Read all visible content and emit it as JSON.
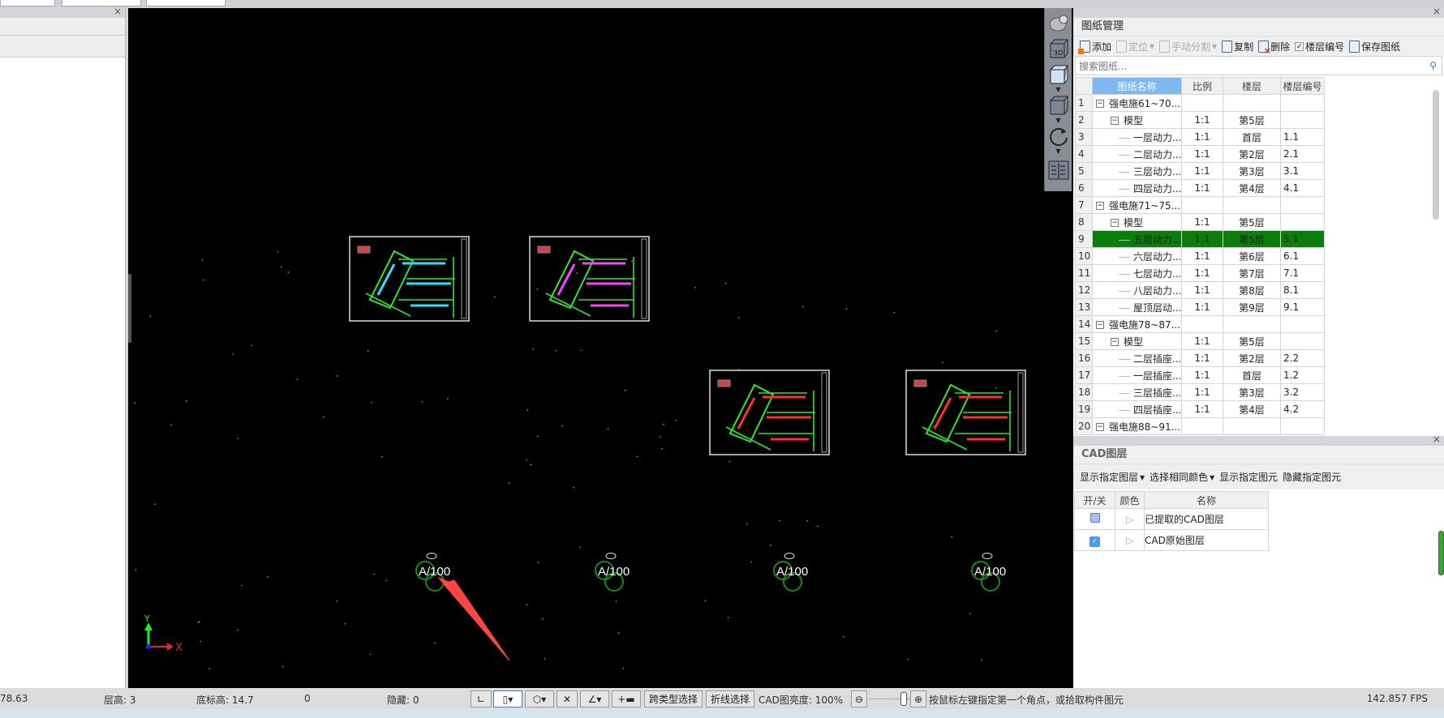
{
  "drawing_panel": {
    "title": "图纸管理",
    "toolbar": {
      "add": "添加",
      "locate": "定位",
      "split": "手动分割",
      "copy": "复制",
      "delete": "删除",
      "floor_code": "楼层编号",
      "save": "保存图纸"
    },
    "search_placeholder": "搜索图纸...",
    "columns": [
      "图纸名称",
      "比例",
      "楼层",
      "楼层编号"
    ],
    "rows": [
      {
        "n": "1",
        "name": "强电施61~70...",
        "scale": "",
        "floor": "",
        "code": "",
        "level": 0
      },
      {
        "n": "2",
        "name": "模型",
        "scale": "1:1",
        "floor": "第5层",
        "code": "",
        "level": 1
      },
      {
        "n": "3",
        "name": "一层动力...",
        "scale": "1:1",
        "floor": "首层",
        "code": "1.1",
        "level": 2
      },
      {
        "n": "4",
        "name": "二层动力...",
        "scale": "1:1",
        "floor": "第2层",
        "code": "2.1",
        "level": 2
      },
      {
        "n": "5",
        "name": "三层动力...",
        "scale": "1:1",
        "floor": "第3层",
        "code": "3.1",
        "level": 2
      },
      {
        "n": "6",
        "name": "四层动力...",
        "scale": "1:1",
        "floor": "第4层",
        "code": "4.1",
        "level": 2
      },
      {
        "n": "7",
        "name": "强电施71~75...",
        "scale": "",
        "floor": "",
        "code": "",
        "level": 0
      },
      {
        "n": "8",
        "name": "模型",
        "scale": "1:1",
        "floor": "第5层",
        "code": "",
        "level": 1
      },
      {
        "n": "9",
        "name": "五层动力...",
        "scale": "1:1",
        "floor": "第5层",
        "code": "5.1",
        "level": 2,
        "selected": true
      },
      {
        "n": "10",
        "name": "六层动力...",
        "scale": "1:1",
        "floor": "第6层",
        "code": "6.1",
        "level": 2
      },
      {
        "n": "11",
        "name": "七层动力...",
        "scale": "1:1",
        "floor": "第7层",
        "code": "7.1",
        "level": 2
      },
      {
        "n": "12",
        "name": "八层动力...",
        "scale": "1:1",
        "floor": "第8层",
        "code": "8.1",
        "level": 2
      },
      {
        "n": "13",
        "name": "屋顶层动...",
        "scale": "1:1",
        "floor": "第9层",
        "code": "9.1",
        "level": 2
      },
      {
        "n": "14",
        "name": "强电施78~87...",
        "scale": "",
        "floor": "",
        "code": "",
        "level": 0
      },
      {
        "n": "15",
        "name": "模型",
        "scale": "1:1",
        "floor": "第5层",
        "code": "",
        "level": 1
      },
      {
        "n": "16",
        "name": "二层插座...",
        "scale": "1:1",
        "floor": "第2层",
        "code": "2.2",
        "level": 2
      },
      {
        "n": "17",
        "name": "一层插座...",
        "scale": "1:1",
        "floor": "首层",
        "code": "1.2",
        "level": 2
      },
      {
        "n": "18",
        "name": "三层插座...",
        "scale": "1:1",
        "floor": "第3层",
        "code": "3.2",
        "level": 2
      },
      {
        "n": "19",
        "name": "四层插座...",
        "scale": "1:1",
        "floor": "第4层",
        "code": "4.2",
        "level": 2
      },
      {
        "n": "20",
        "name": "强电施88~91...",
        "scale": "",
        "floor": "",
        "code": "",
        "level": 0
      }
    ],
    "selected_color": "#0a7d0a"
  },
  "cad_layer_panel": {
    "title": "CAD图层",
    "toolbar": {
      "show_layer": "显示指定图层",
      "select_color": "选择相同颜色",
      "show_element": "显示指定图元",
      "hide_element": "隐藏指定图元"
    },
    "columns": [
      "开/关",
      "颜色",
      "名称"
    ],
    "rows": [
      {
        "name": "已提取的CAD图层",
        "checked": false
      },
      {
        "name": "CAD原始图层",
        "checked": true
      }
    ]
  },
  "viewport": {
    "axis_x": "X",
    "axis_y": "Y",
    "marker_text": "A/100"
  },
  "status": {
    "coord": "78.63",
    "floor_height": "层高: 3",
    "base_elev": "底标高: 14.7",
    "zero": "0",
    "hidden": "隐藏: 0",
    "cross_type": "跨类型选择",
    "polyline": "折线选择",
    "brightness": "CAD图亮度: 100%",
    "brightness_value": 100,
    "prompt": "按鼠标左键指定第一个角点，或拾取构件图元",
    "fps": "142.857 FPS"
  }
}
